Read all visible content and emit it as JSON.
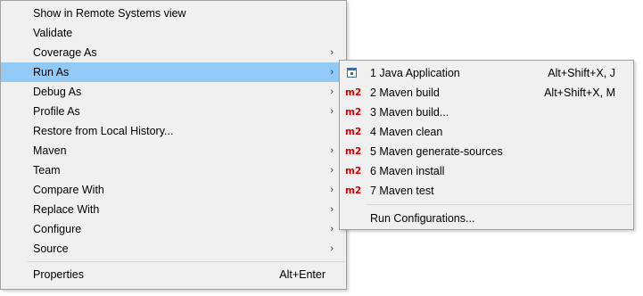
{
  "main_menu": {
    "items": [
      {
        "label": "Show in Remote Systems view",
        "has_submenu": false
      },
      {
        "label": "Validate",
        "has_submenu": false
      },
      {
        "label": "Coverage As",
        "has_submenu": true
      },
      {
        "label": "Run As",
        "has_submenu": true,
        "highlighted": true
      },
      {
        "label": "Debug As",
        "has_submenu": true
      },
      {
        "label": "Profile As",
        "has_submenu": true
      },
      {
        "label": "Restore from Local History...",
        "has_submenu": false
      },
      {
        "label": "Maven",
        "has_submenu": true
      },
      {
        "label": "Team",
        "has_submenu": true
      },
      {
        "label": "Compare With",
        "has_submenu": true
      },
      {
        "label": "Replace With",
        "has_submenu": true
      },
      {
        "label": "Configure",
        "has_submenu": true
      },
      {
        "label": "Source",
        "has_submenu": true
      }
    ],
    "properties": {
      "label": "Properties",
      "shortcut": "Alt+Enter"
    },
    "arrow_glyph": "›"
  },
  "run_as_submenu": {
    "items": [
      {
        "label": "1 Java Application",
        "shortcut": "Alt+Shift+X, J",
        "icon": "java-app-icon"
      },
      {
        "label": "2 Maven build",
        "shortcut": "Alt+Shift+X, M",
        "icon": "maven-m2-icon",
        "icon_text": "m2"
      },
      {
        "label": "3 Maven build...",
        "shortcut": "",
        "icon": "maven-m2-icon",
        "icon_text": "m2"
      },
      {
        "label": "4 Maven clean",
        "shortcut": "",
        "icon": "maven-m2-icon",
        "icon_text": "m2"
      },
      {
        "label": "5 Maven generate-sources",
        "shortcut": "",
        "icon": "maven-m2-icon",
        "icon_text": "m2"
      },
      {
        "label": "6 Maven install",
        "shortcut": "",
        "icon": "maven-m2-icon",
        "icon_text": "m2"
      },
      {
        "label": "7 Maven test",
        "shortcut": "",
        "icon": "maven-m2-icon",
        "icon_text": "m2"
      }
    ],
    "run_configurations": {
      "label": "Run Configurations..."
    }
  },
  "colors": {
    "menu_background": "#f0f0f0",
    "highlight": "#91c9f7",
    "maven_icon": "#d40000",
    "border": "#a0a0a0"
  }
}
